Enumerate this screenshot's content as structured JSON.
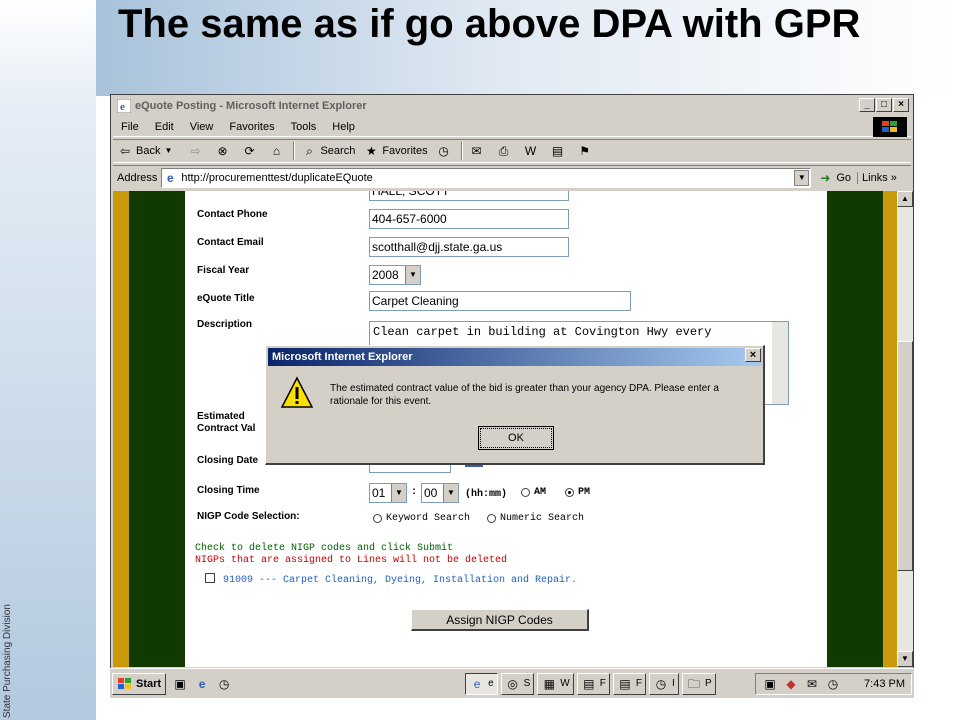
{
  "slide": {
    "title": "The same as if go above DPA with GPR",
    "side_label": "State Purchasing Division"
  },
  "window": {
    "title": "eQuote Posting - Microsoft Internet Explorer",
    "min_btn": "_",
    "max_btn": "□",
    "close_btn": "×"
  },
  "menu": [
    "File",
    "Edit",
    "View",
    "Favorites",
    "Tools",
    "Help"
  ],
  "toolbar": {
    "back": "Back",
    "search": "Search",
    "favorites": "Favorites"
  },
  "address": {
    "label": "Address",
    "url": "http://procurementtest/duplicateEQuote",
    "go": "Go",
    "links": "Links"
  },
  "form": {
    "contact_name_value": "HALL, SCOTT",
    "contact_phone_label": "Contact Phone",
    "contact_phone_value": "404-657-6000",
    "contact_email_label": "Contact Email",
    "contact_email_value": "scotthall@djj.state.ga.us",
    "fiscal_year_label": "Fiscal Year",
    "fiscal_year_value": "2008",
    "equote_title_label": "eQuote Title",
    "equote_title_value": "Carpet Cleaning",
    "description_label": "Description",
    "description_value": "Clean carpet in building at Covington Hwy every",
    "estimated_label_1": "Estimated",
    "estimated_label_2": "Contract Val",
    "closing_date_label": "Closing Date",
    "closing_time_label": "Closing Time",
    "hour_value": "01",
    "minute_value": "00",
    "colon": ":",
    "time_format": "(hh:mm)",
    "am_label": "AM",
    "pm_label": "PM",
    "nigp_selection_label": "NIGP Code Selection:",
    "keyword_search_label": "Keyword Search",
    "numeric_search_label": "Numeric Search",
    "delete_note": "Check to delete NIGP codes and click Submit",
    "lines_note": "NIGPs that are assigned to Lines will not be deleted",
    "nigp_item": "91009 --- Carpet Cleaning, Dyeing, Installation and Repair.",
    "assign_button": "Assign NIGP Codes"
  },
  "dialog": {
    "title": "Microsoft Internet Explorer",
    "message": "The estimated contract value of the bid is greater than your agency DPA. Please enter a rationale for this event.",
    "ok": "OK"
  },
  "taskbar": {
    "start": "Start",
    "tasks": [
      "e",
      "S",
      "W",
      "F",
      "F",
      "I",
      "P"
    ],
    "clock": "7:43 PM"
  }
}
